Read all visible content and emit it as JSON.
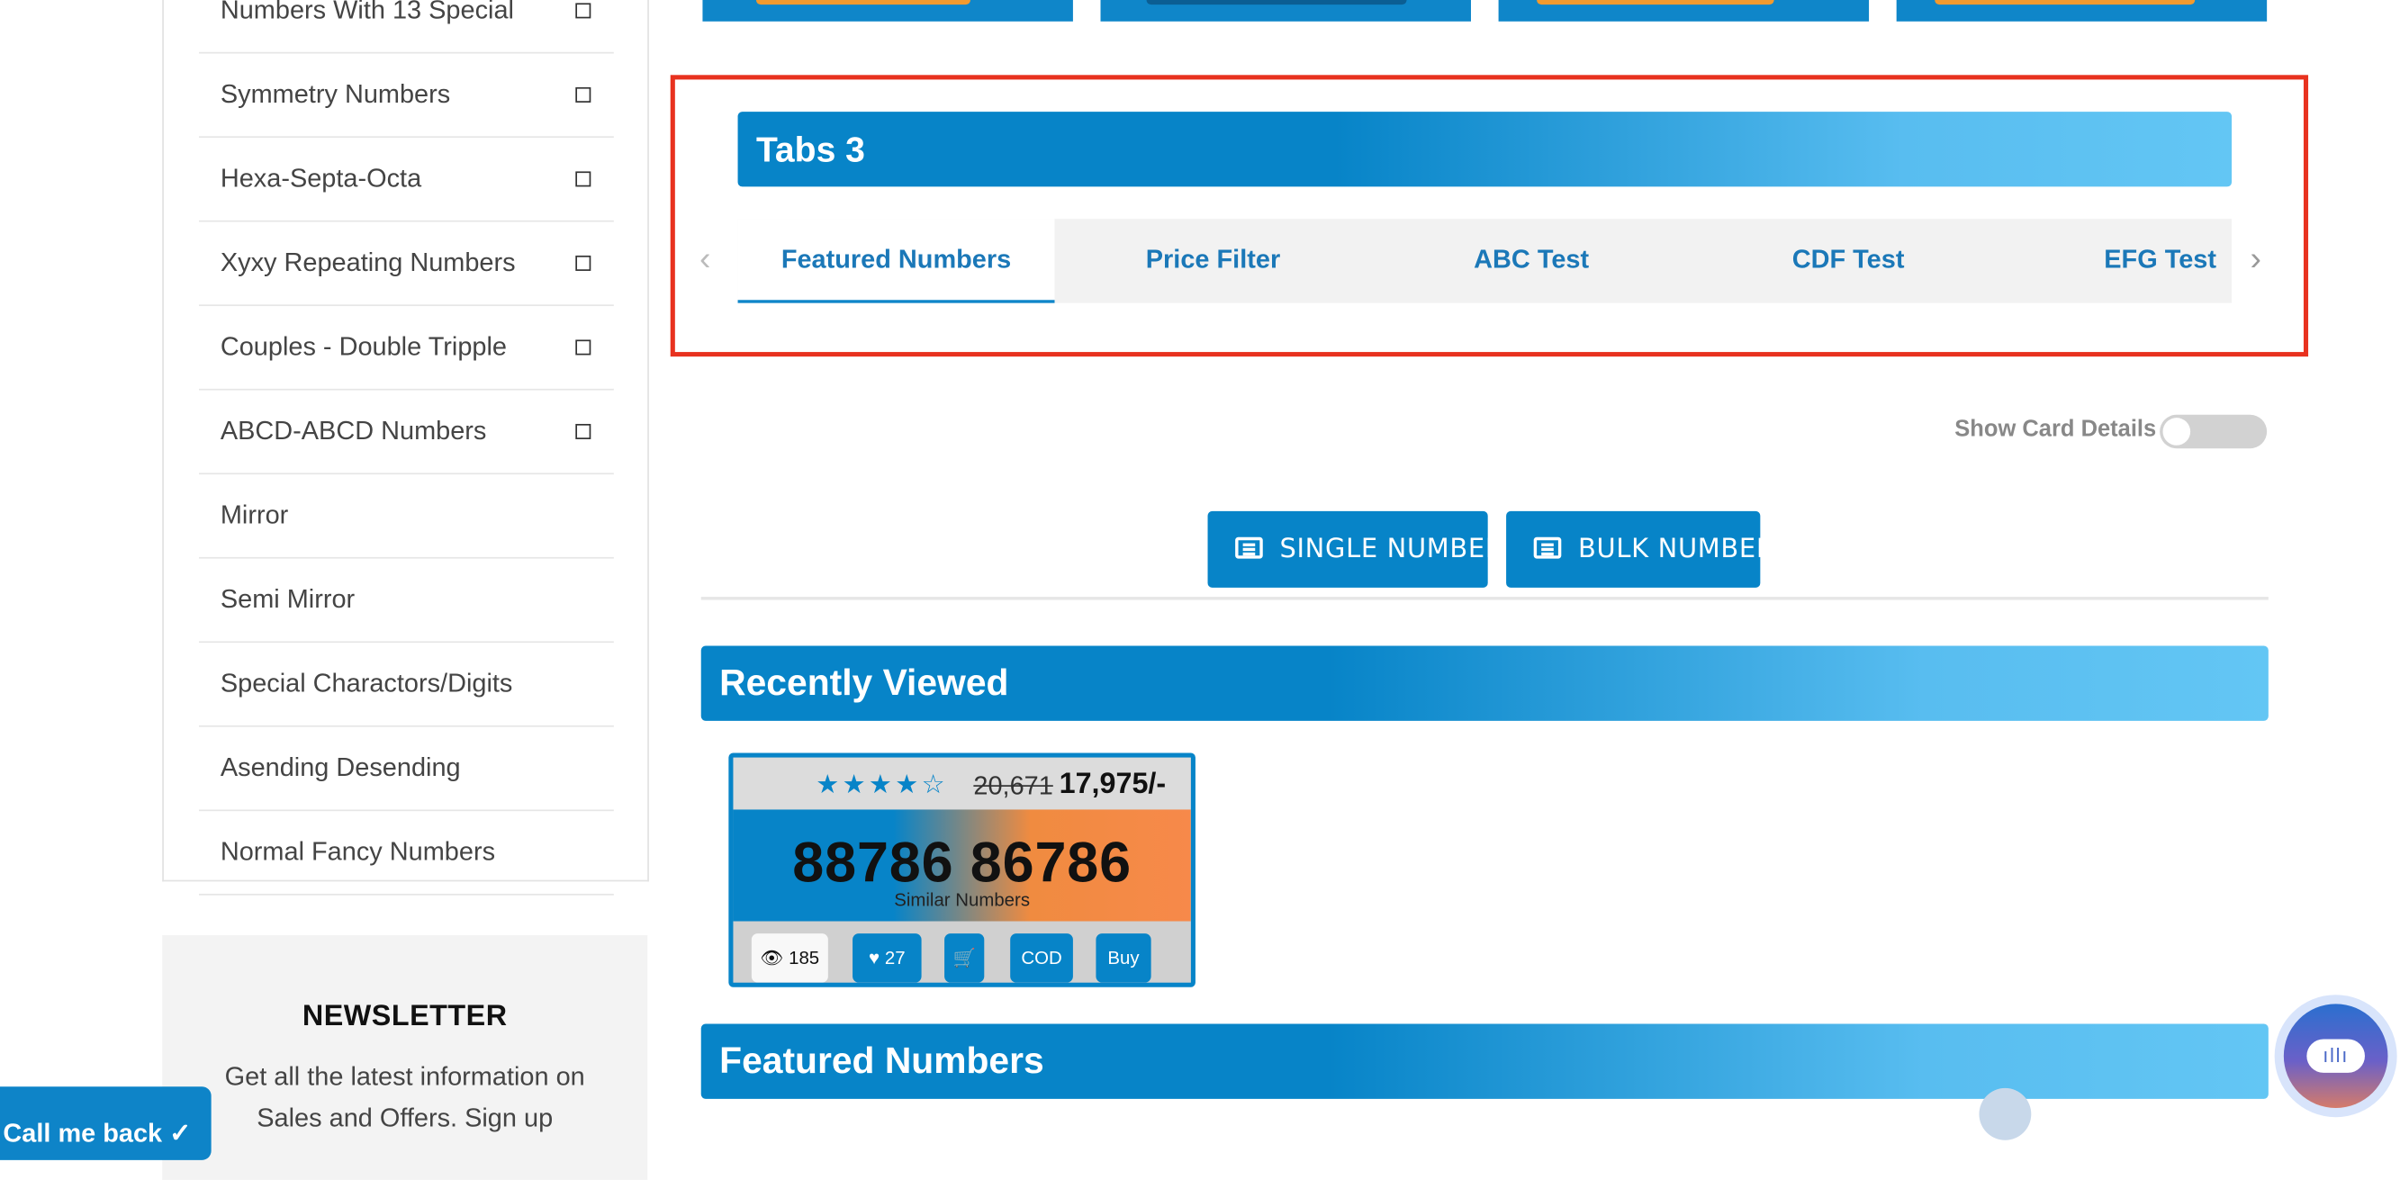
{
  "sidebar": {
    "items": [
      {
        "label": "Numbers With 13 Special",
        "checkbox": true
      },
      {
        "label": "Symmetry Numbers",
        "checkbox": true
      },
      {
        "label": "Hexa-Septa-Octa",
        "checkbox": true
      },
      {
        "label": "Xyxy Repeating Numbers",
        "checkbox": true
      },
      {
        "label": "Couples - Double Tripple",
        "checkbox": true
      },
      {
        "label": "ABCD-ABCD Numbers",
        "checkbox": true
      },
      {
        "label": "Mirror",
        "checkbox": false
      },
      {
        "label": "Semi Mirror",
        "checkbox": false
      },
      {
        "label": "Special Charactors/Digits",
        "checkbox": false
      },
      {
        "label": "Asending Desending",
        "checkbox": false
      },
      {
        "label": "Normal Fancy Numbers",
        "checkbox": false
      }
    ]
  },
  "newsletter": {
    "title": "NEWSLETTER",
    "text": "Get all the latest information on Sales and Offers. Sign up"
  },
  "call_me_back": {
    "label": "Call me back ✓"
  },
  "tabs_section": {
    "title": "Tabs 3",
    "tabs": [
      {
        "label": "Featured Numbers",
        "active": true
      },
      {
        "label": "Price Filter",
        "active": false
      },
      {
        "label": "ABC Test",
        "active": false
      },
      {
        "label": "CDF Test",
        "active": false
      },
      {
        "label": "EFG Test",
        "active": false
      }
    ],
    "prev_icon": "chevron-left-icon",
    "next_icon": "chevron-right-icon"
  },
  "card_details_toggle": {
    "label": "Show Card Details",
    "on": false
  },
  "number_type_buttons": {
    "single": "SINGLE NUMBERS",
    "bulk": "BULK NUMBERS"
  },
  "recently_viewed": {
    "title": "Recently Viewed",
    "card": {
      "rating": 4,
      "max_rating": 5,
      "old_price": "20,671",
      "new_price": "17,975/-",
      "number": "88786 86786",
      "subtitle": "Similar Numbers",
      "views": "185",
      "likes": "27",
      "cod_label": "COD",
      "buy_label": "Buy"
    }
  },
  "featured_numbers": {
    "title": "Featured Numbers"
  },
  "colors": {
    "primary": "#0784c8",
    "accent_light": "#63c6f4",
    "highlight_border": "#e8321f",
    "orange": "#f7894a"
  }
}
